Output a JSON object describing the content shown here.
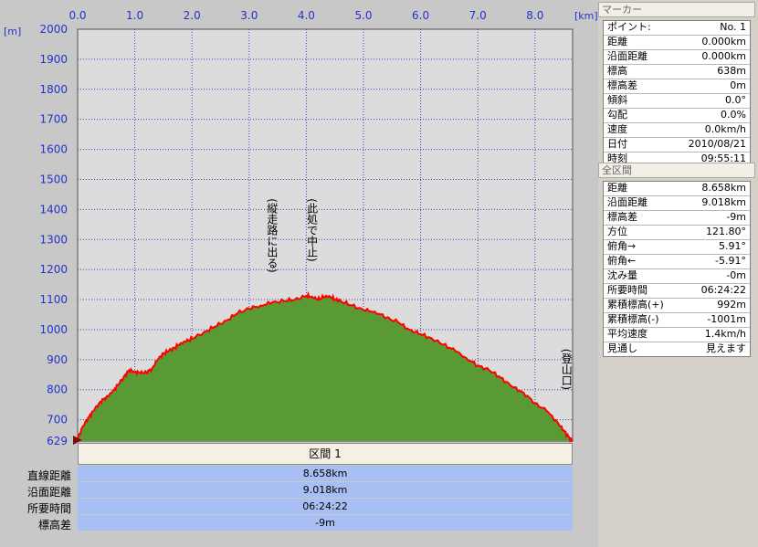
{
  "chart_data": {
    "type": "area",
    "x_unit": "[km]",
    "y_unit": "[m]",
    "xlim": [
      0.0,
      8.658
    ],
    "ylim": [
      629,
      2000
    ],
    "x_ticks": [
      "0.0",
      "1.0",
      "2.0",
      "3.0",
      "4.0",
      "5.0",
      "6.0",
      "7.0",
      "8.0"
    ],
    "y_ticks": [
      "2000",
      "1900",
      "1800",
      "1700",
      "1600",
      "1500",
      "1400",
      "1300",
      "1200",
      "1100",
      "1000",
      "900",
      "800",
      "700"
    ],
    "y_min_label": "629",
    "fill_color": "#5a9a34",
    "line_color": "#ff0000",
    "grid": true,
    "profile_x": [
      0.0,
      0.1,
      0.2,
      0.3,
      0.4,
      0.5,
      0.6,
      0.7,
      0.8,
      0.9,
      1.0,
      1.1,
      1.2,
      1.3,
      1.4,
      1.5,
      1.6,
      1.7,
      1.8,
      1.9,
      2.0,
      2.2,
      2.4,
      2.6,
      2.8,
      3.0,
      3.2,
      3.4,
      3.6,
      3.8,
      4.0,
      4.1,
      4.2,
      4.3,
      4.4,
      4.5,
      4.6,
      4.8,
      5.0,
      5.2,
      5.4,
      5.6,
      5.8,
      6.0,
      6.2,
      6.4,
      6.6,
      6.8,
      7.0,
      7.2,
      7.4,
      7.6,
      7.8,
      8.0,
      8.2,
      8.4,
      8.5,
      8.6,
      8.658
    ],
    "profile_y": [
      638,
      680,
      710,
      735,
      760,
      775,
      790,
      815,
      840,
      865,
      860,
      855,
      858,
      870,
      900,
      920,
      930,
      940,
      955,
      960,
      970,
      990,
      1010,
      1030,
      1055,
      1070,
      1080,
      1090,
      1095,
      1100,
      1112,
      1110,
      1100,
      1108,
      1112,
      1100,
      1095,
      1080,
      1065,
      1060,
      1040,
      1025,
      1000,
      985,
      970,
      950,
      930,
      905,
      880,
      865,
      840,
      810,
      790,
      755,
      730,
      690,
      665,
      640,
      629
    ],
    "annotations": [
      {
        "text": "(縦走路に出る)",
        "x": 3.4,
        "y": 1300
      },
      {
        "text": "(此処で中止)",
        "x": 4.1,
        "y": 1300
      },
      {
        "text": "(登山口)",
        "x": 8.55,
        "y": 800
      }
    ]
  },
  "section": {
    "title": "区間 1",
    "rows": [
      {
        "label": "直線距離",
        "value": "8.658km"
      },
      {
        "label": "沿面距離",
        "value": "9.018km"
      },
      {
        "label": "所要時間",
        "value": "06:24:22"
      },
      {
        "label": "標高差",
        "value": "-9m"
      }
    ]
  },
  "marker_panel": {
    "title": "マーカー",
    "rows": [
      {
        "label": "ポイント:",
        "value": "No. 1"
      },
      {
        "label": "距離",
        "value": "0.000km"
      },
      {
        "label": "沿面距離",
        "value": "0.000km"
      },
      {
        "label": "標高",
        "value": "638m"
      },
      {
        "label": "標高差",
        "value": "0m"
      },
      {
        "label": "傾斜",
        "value": "0.0°"
      },
      {
        "label": "勾配",
        "value": "0.0%"
      },
      {
        "label": "速度",
        "value": "0.0km/h"
      },
      {
        "label": "日付",
        "value": "2010/08/21"
      },
      {
        "label": "時刻",
        "value": "09:55:11"
      }
    ]
  },
  "total_panel": {
    "title": "全区間",
    "rows": [
      {
        "label": "距離",
        "value": "8.658km"
      },
      {
        "label": "沿面距離",
        "value": "9.018km"
      },
      {
        "label": "標高差",
        "value": "-9m"
      },
      {
        "label": "方位",
        "value": "121.80°"
      },
      {
        "label": "俯角→",
        "value": "5.91°"
      },
      {
        "label": "俯角←",
        "value": "-5.91°"
      },
      {
        "label": "沈み量",
        "value": "-0m"
      },
      {
        "label": "所要時間",
        "value": "06:24:22"
      },
      {
        "label": "累積標高(+)",
        "value": "992m"
      },
      {
        "label": "累積標高(-)",
        "value": "-1001m"
      },
      {
        "label": "平均速度",
        "value": "1.4km/h"
      },
      {
        "label": "見通し",
        "value": "見えます"
      }
    ]
  }
}
